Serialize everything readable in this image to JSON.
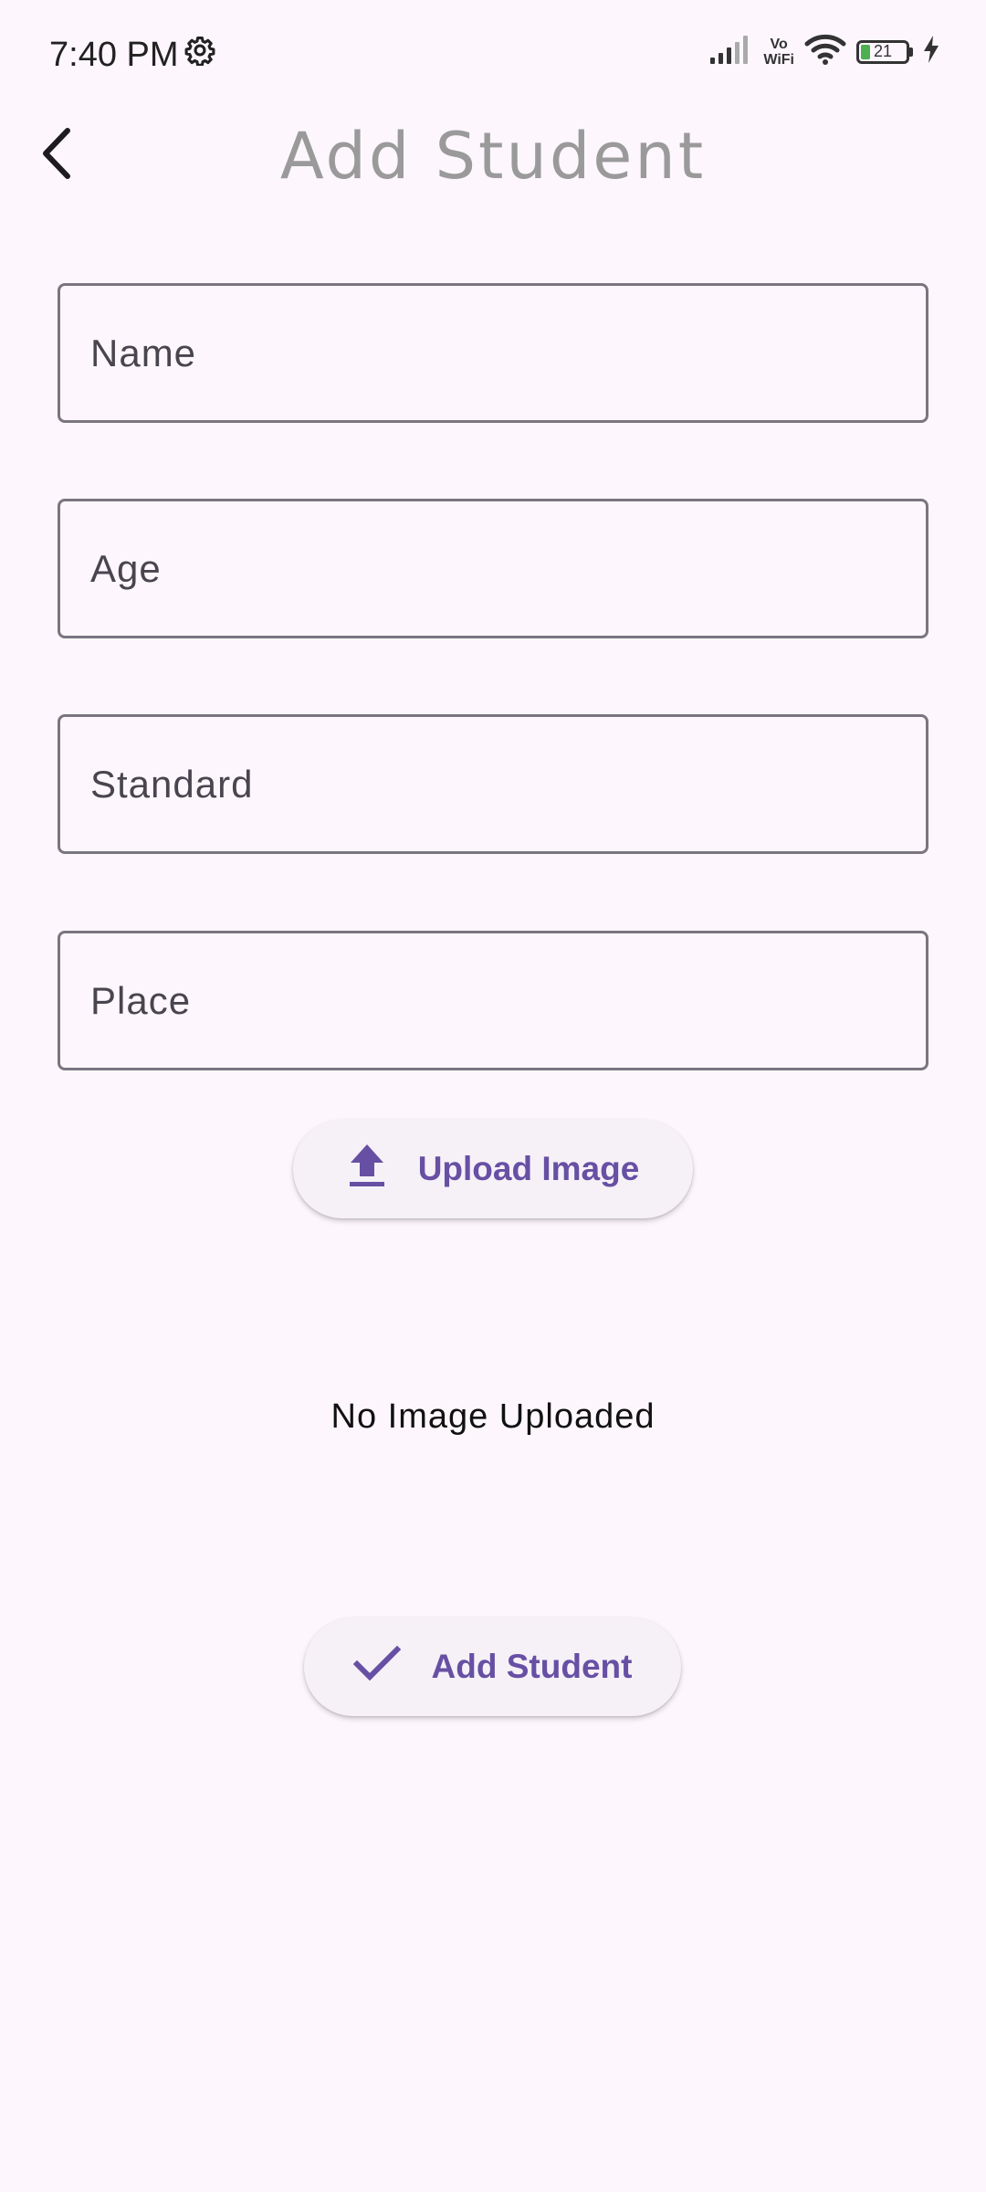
{
  "status_bar": {
    "time": "7:40 PM",
    "vowifi_top": "Vo",
    "vowifi_bottom": "WiFi",
    "battery_level": "21"
  },
  "app_bar": {
    "title": "Add Student"
  },
  "form": {
    "name_placeholder": "Name",
    "age_placeholder": "Age",
    "standard_placeholder": "Standard",
    "place_placeholder": "Place",
    "name_value": "",
    "age_value": "",
    "standard_value": "",
    "place_value": ""
  },
  "upload": {
    "label": "Upload Image",
    "status_text": "No Image Uploaded"
  },
  "submit": {
    "label": "Add Student"
  },
  "colors": {
    "accent": "#6750a4",
    "background": "#fdf7fd",
    "outline": "#7a757f",
    "title": "#9a9a9a"
  },
  "icons": {
    "settings": "gear-icon",
    "back": "back-arrow-icon",
    "upload": "upload-icon",
    "check": "check-icon",
    "signal": "signal-icon",
    "wifi": "wifi-icon",
    "battery": "battery-icon",
    "charging": "charging-icon"
  }
}
